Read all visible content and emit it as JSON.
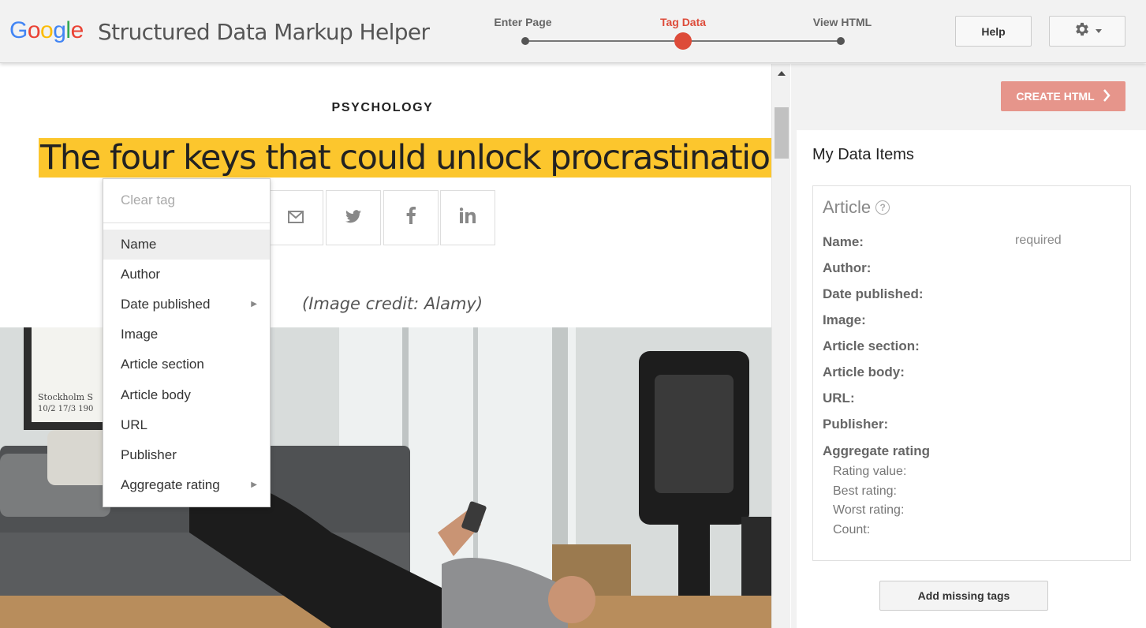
{
  "header": {
    "logo_letters": [
      {
        "ch": "G",
        "color": "#4285F4"
      },
      {
        "ch": "o",
        "color": "#EA4335"
      },
      {
        "ch": "o",
        "color": "#FBBC05"
      },
      {
        "ch": "g",
        "color": "#4285F4"
      },
      {
        "ch": "l",
        "color": "#34A853"
      },
      {
        "ch": "e",
        "color": "#EA4335"
      }
    ],
    "title": "Structured Data Markup Helper",
    "steps": [
      {
        "label": "Enter Page",
        "active": false
      },
      {
        "label": "Tag Data",
        "active": true
      },
      {
        "label": "View HTML",
        "active": false
      }
    ],
    "help_label": "Help",
    "gear_icon": "gear-icon"
  },
  "article": {
    "category": "PSYCHOLOGY",
    "headline": "The four keys that could unlock procrastination",
    "share_icons": [
      "email-icon",
      "twitter-icon",
      "facebook-icon",
      "linkedin-icon"
    ],
    "image_credit": "(Image credit: Alamy)"
  },
  "context_menu": {
    "clear_tag": "Clear tag",
    "items": [
      {
        "label": "Name",
        "submenu": false,
        "hover": true
      },
      {
        "label": "Author",
        "submenu": false,
        "hover": false
      },
      {
        "label": "Date published",
        "submenu": true,
        "hover": false
      },
      {
        "label": "Image",
        "submenu": false,
        "hover": false
      },
      {
        "label": "Article section",
        "submenu": false,
        "hover": false
      },
      {
        "label": "Article body",
        "submenu": false,
        "hover": false
      },
      {
        "label": "URL",
        "submenu": false,
        "hover": false
      },
      {
        "label": "Publisher",
        "submenu": false,
        "hover": false
      },
      {
        "label": "Aggregate rating",
        "submenu": true,
        "hover": false
      }
    ]
  },
  "sidebar": {
    "create_html_label": "CREATE HTML",
    "my_data_items_title": "My Data Items",
    "article_type": "Article",
    "required_label": "required",
    "properties": [
      "Name:",
      "Author:",
      "Date published:",
      "Image:",
      "Article section:",
      "Article body:",
      "URL:",
      "Publisher:"
    ],
    "aggregate_rating": "Aggregate rating",
    "rating_subprops": [
      "Rating value:",
      "Best rating:",
      "Worst rating:",
      "Count:"
    ],
    "add_missing_label": "Add missing tags"
  },
  "colors": {
    "accent_red": "#dd4b39",
    "highlight_yellow": "#fcc62d",
    "create_button": "#e6958b"
  }
}
